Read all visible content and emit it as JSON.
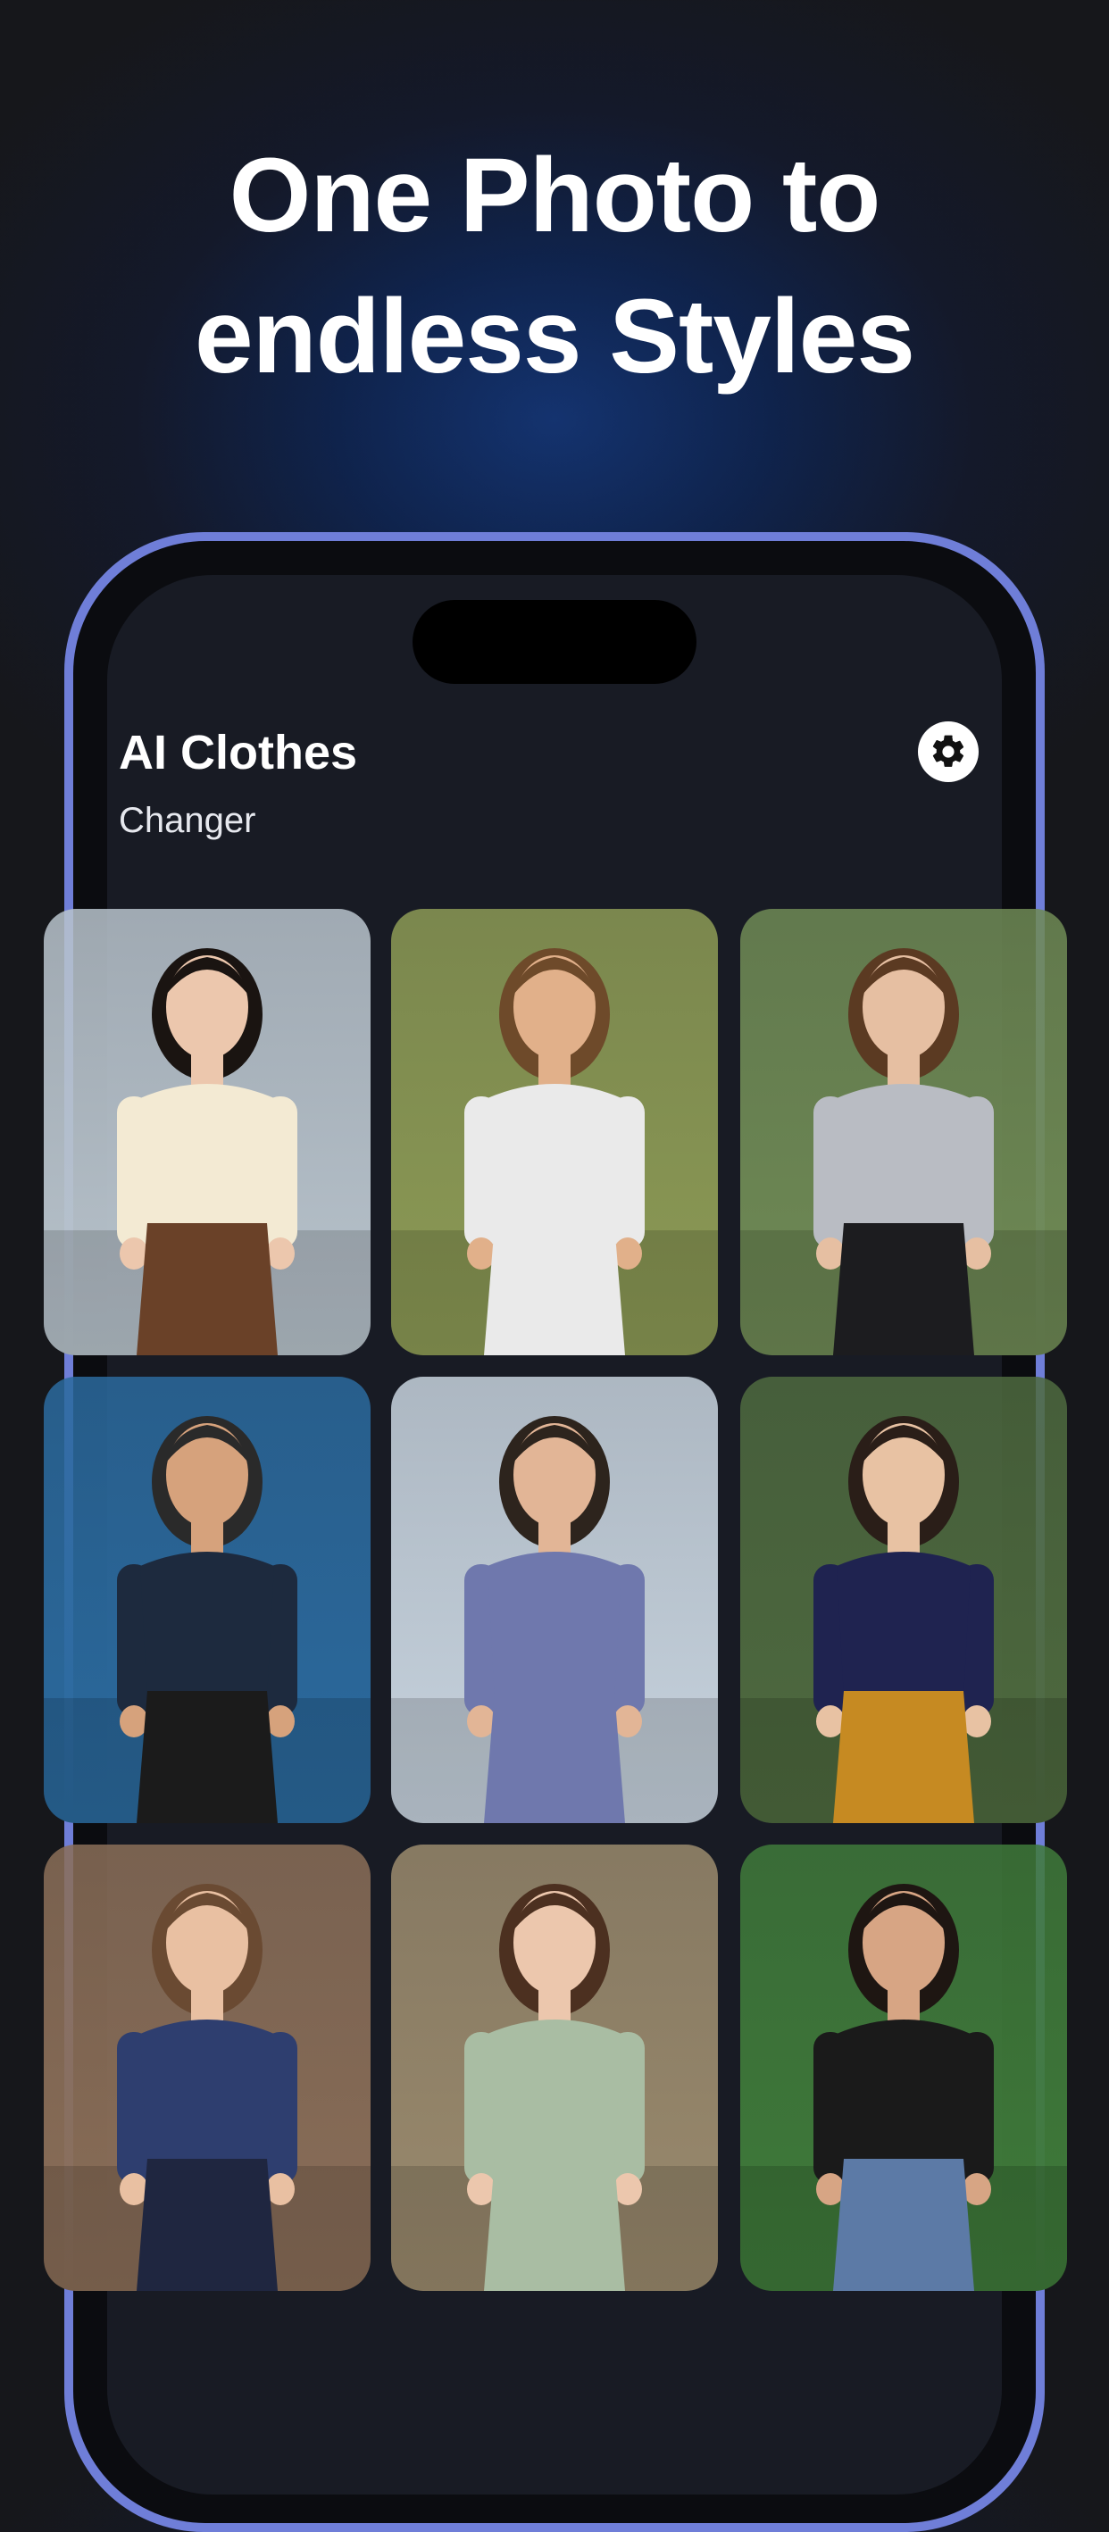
{
  "headline": {
    "line1": "One Photo to",
    "line2": "endless Styles"
  },
  "app": {
    "title": "AI Clothes",
    "subtitle": "Changer",
    "settings_icon": "gear-icon"
  },
  "gallery": {
    "items": [
      {
        "name": "woman-cream-blouse",
        "bg": "#b8c3cc",
        "top": "#f3ead3",
        "bottom": "#6a4128",
        "hair": "#1a1411",
        "skin": "#ecc7ad"
      },
      {
        "name": "woman-striped-dress",
        "bg": "#8c9a55",
        "top": "#eaeaea",
        "bottom": "#eaeaea",
        "hair": "#6e4a2a",
        "skin": "#e1b08a"
      },
      {
        "name": "woman-gray-hoodie",
        "bg": "#6f8a55",
        "top": "#b9bcc3",
        "bottom": "#1c1c1f",
        "hair": "#5b3a22",
        "skin": "#e6bfa2"
      },
      {
        "name": "man-baseball-outfit",
        "bg": "#2b6a9e",
        "top": "#1d2a3e",
        "bottom": "#1b1b1b",
        "hair": "#2a2a2a",
        "skin": "#d6a27c"
      },
      {
        "name": "man-blue-suit",
        "bg": "#c7d3de",
        "top": "#6f78ad",
        "bottom": "#6f78ad",
        "hair": "#2d241d",
        "skin": "#e2b596"
      },
      {
        "name": "man-navy-polo",
        "bg": "#4e6a3f",
        "top": "#1f2350",
        "bottom": "#c68a22",
        "hair": "#2a1e18",
        "skin": "#e8c2a3"
      },
      {
        "name": "woman-denim-shirt",
        "bg": "#8a6e58",
        "top": "#2e3e6f",
        "bottom": "#1f2640",
        "hair": "#6a4a32",
        "skin": "#e9c0a2"
      },
      {
        "name": "woman-sage-gown",
        "bg": "#9a8a6d",
        "top": "#a9bda3",
        "bottom": "#a9bda3",
        "hair": "#4c3020",
        "skin": "#ecc7ad"
      },
      {
        "name": "woman-stadium-jersey",
        "bg": "#3f7a3a",
        "top": "#1a1a1a",
        "bottom": "#5c7aa6",
        "hair": "#1e1612",
        "skin": "#d7a584"
      }
    ]
  }
}
